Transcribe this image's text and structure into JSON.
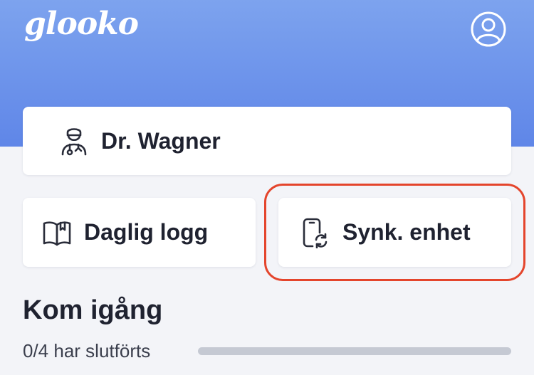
{
  "header": {
    "logo_text": "glooko",
    "profile_icon": "account-circle-icon",
    "background_color": "#6b8fea"
  },
  "cards": {
    "doctor": {
      "label": "Dr. Wagner",
      "icon": "doctor-icon"
    },
    "daily_log": {
      "label": "Daglig logg",
      "icon": "book-icon"
    },
    "sync_device": {
      "label": "Synk. enhet",
      "icon": "phone-sync-icon"
    }
  },
  "get_started": {
    "title": "Kom igång",
    "progress_text": "0/4 har slutförts",
    "progress_fraction": 0
  },
  "colors": {
    "highlight": "#e4452c",
    "progress_track": "#c5c9d3",
    "text": "#1f2230"
  }
}
